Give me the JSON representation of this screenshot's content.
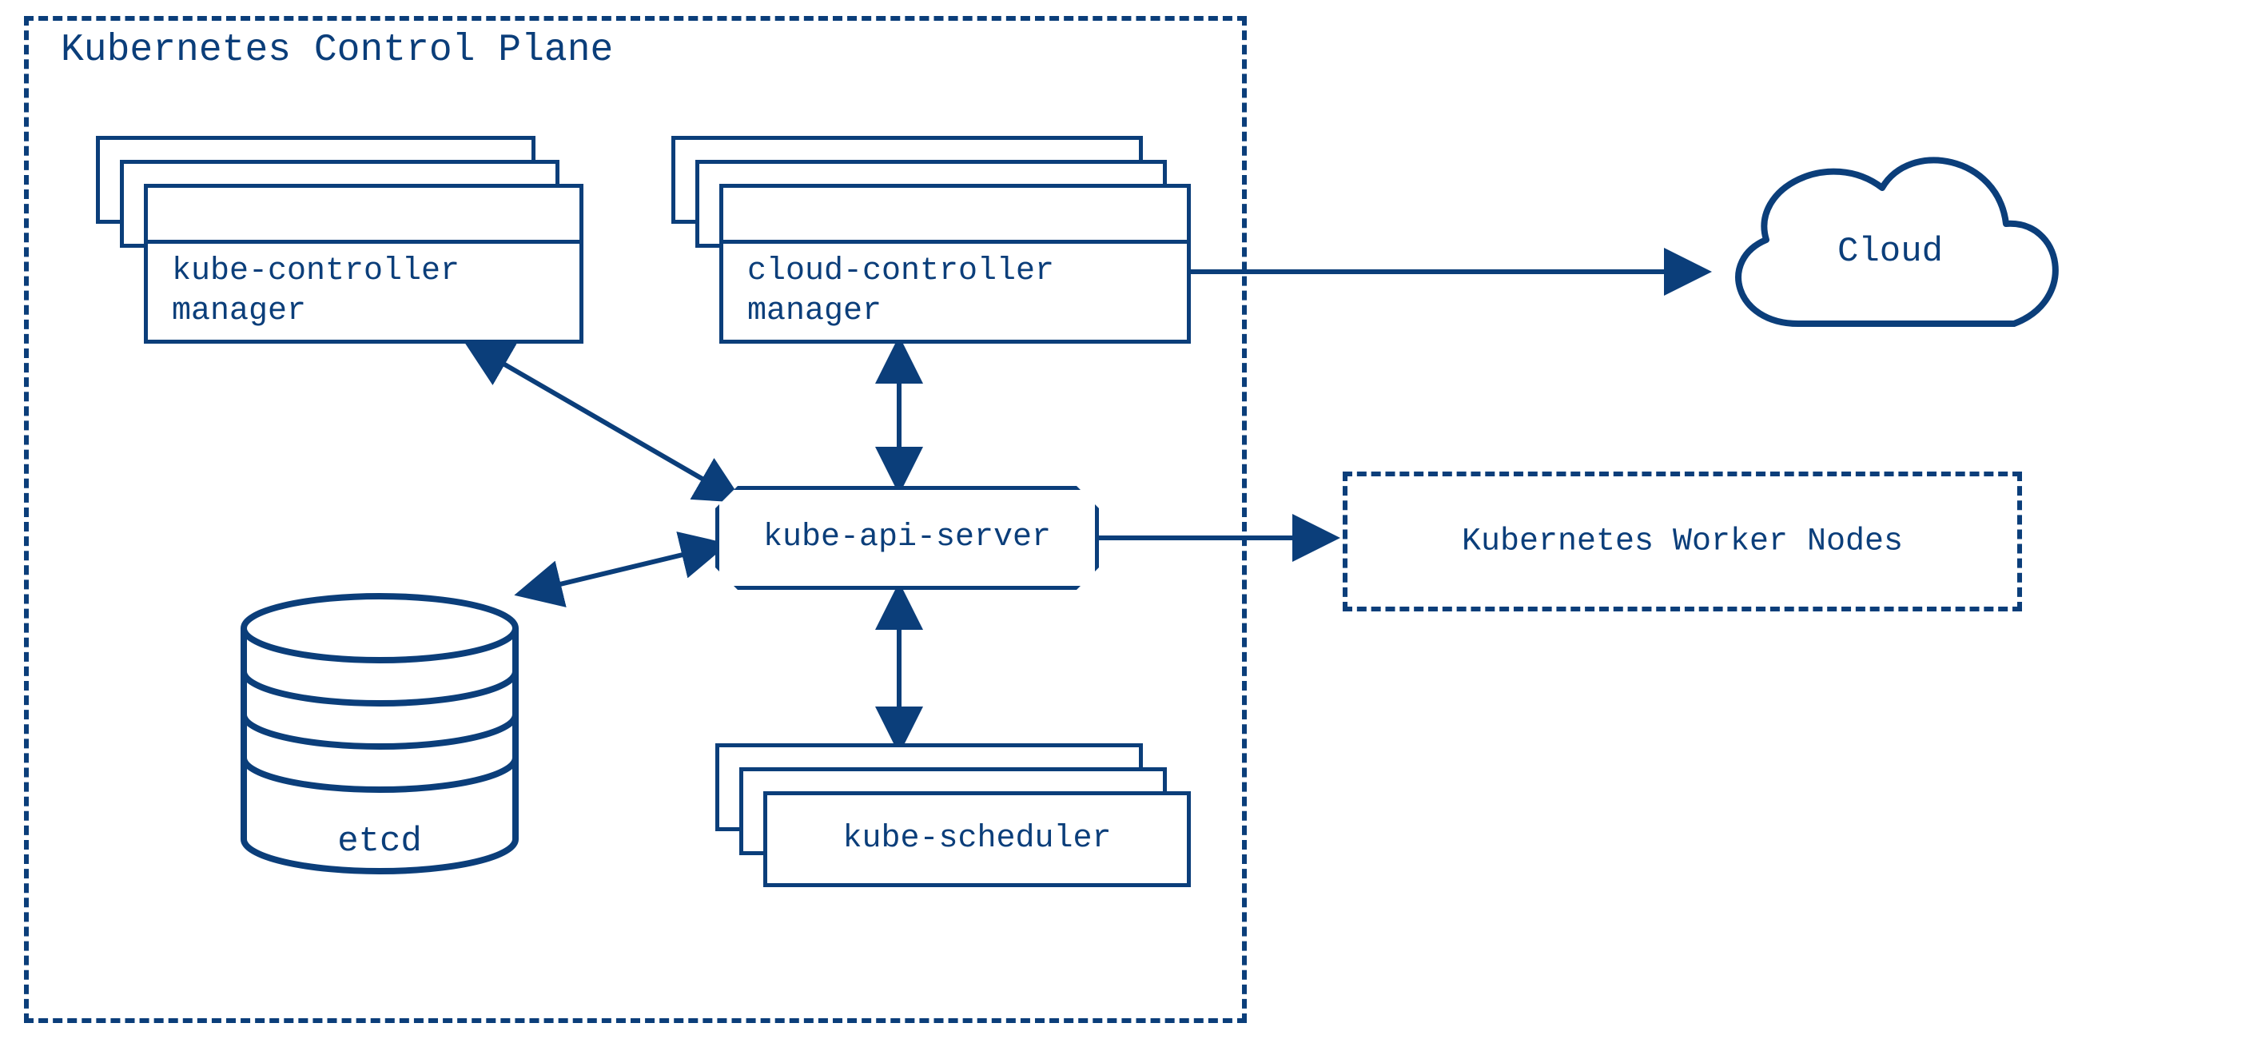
{
  "colors": {
    "stroke": "#0b3e7a",
    "label": "#0b3e7a"
  },
  "control_plane": {
    "title": "Kubernetes Control Plane"
  },
  "components": {
    "kube_controller_manager": "kube-controller\nmanager",
    "cloud_controller_manager": "cloud-controller\nmanager",
    "kube_api_server": "kube-api-server",
    "kube_scheduler": "kube-scheduler",
    "etcd": "etcd"
  },
  "external": {
    "cloud": "Cloud",
    "worker_nodes": "Kubernetes Worker Nodes"
  },
  "connections": [
    {
      "from": "kube_controller_manager",
      "to": "kube_api_server",
      "bidirectional": true
    },
    {
      "from": "cloud_controller_manager",
      "to": "kube_api_server",
      "bidirectional": true
    },
    {
      "from": "kube_scheduler",
      "to": "kube_api_server",
      "bidirectional": true
    },
    {
      "from": "etcd",
      "to": "kube_api_server",
      "bidirectional": true
    },
    {
      "from": "cloud_controller_manager",
      "to": "cloud",
      "bidirectional": false
    },
    {
      "from": "kube_api_server",
      "to": "worker_nodes",
      "bidirectional": false
    }
  ]
}
